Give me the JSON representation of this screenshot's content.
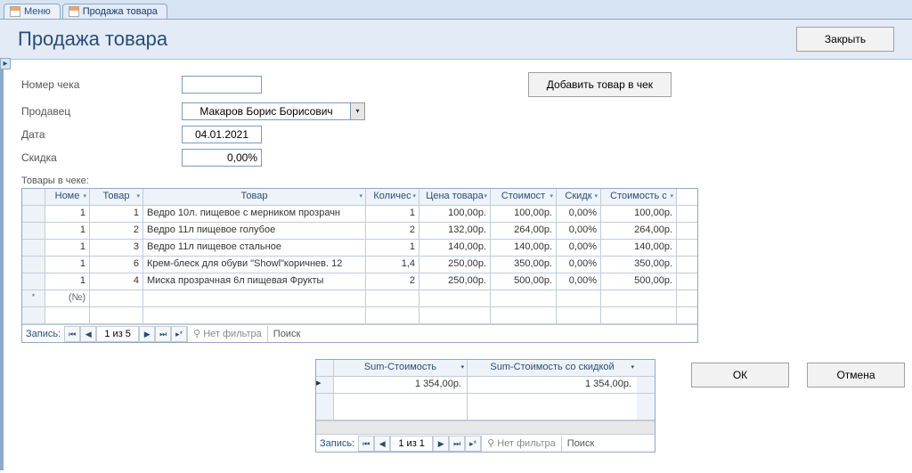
{
  "tabs": [
    {
      "label": "Меню",
      "active": false
    },
    {
      "label": "Продажа товара",
      "active": true
    }
  ],
  "header": {
    "title": "Продажа товара",
    "close_btn": "Закрыть"
  },
  "fields": {
    "check_no_label": "Номер чека",
    "check_no_value": "",
    "seller_label": "Продавец",
    "seller_value": "Макаров Борис Борисович",
    "date_label": "Дата",
    "date_value": "04.01.2021",
    "discount_label": "Скидка",
    "discount_value": "0,00%",
    "add_item_btn": "Добавить товар в чек"
  },
  "items_section_label": "Товары в чеке:",
  "items_columns": {
    "nomer": "Номе",
    "tovar_id": "Товар",
    "tovar": "Товар",
    "kol": "Количес",
    "cena": "Цена товара",
    "stoim": "Стоимост",
    "skidka": "Скидк",
    "stoims": "Стоимость с"
  },
  "items": [
    {
      "nomer": "1",
      "tid": "1",
      "name": "Ведро 10л. пищевое с мерником прозрачн",
      "kol": "1",
      "cena": "100,00р.",
      "stoim": "100,00р.",
      "skid": "0,00%",
      "stoims": "100,00р."
    },
    {
      "nomer": "1",
      "tid": "2",
      "name": "Ведро 11л пищевое голубое",
      "kol": "2",
      "cena": "132,00р.",
      "stoim": "264,00р.",
      "skid": "0,00%",
      "stoims": "264,00р."
    },
    {
      "nomer": "1",
      "tid": "3",
      "name": "Ведро 11л пищевое стальное",
      "kol": "1",
      "cena": "140,00р.",
      "stoim": "140,00р.",
      "skid": "0,00%",
      "stoims": "140,00р."
    },
    {
      "nomer": "1",
      "tid": "6",
      "name": "Крем-блеск для обуви \"Showl\"коричнев. 12",
      "kol": "1,4",
      "cena": "250,00р.",
      "stoim": "350,00р.",
      "skid": "0,00%",
      "stoims": "350,00р."
    },
    {
      "nomer": "1",
      "tid": "4",
      "name": "Миска прозрачная 6л пищевая Фрукты",
      "kol": "2",
      "cena": "250,00р.",
      "stoim": "500,00р.",
      "skid": "0,00%",
      "stoims": "500,00р."
    }
  ],
  "new_row_placeholder": "(№)",
  "nav1": {
    "label": "Запись:",
    "pos": "1 из 5",
    "filter": "Нет фильтра",
    "search": "Поиск"
  },
  "summary_columns": {
    "c1": "Sum-Стоимость",
    "c2": "Sum-Стоимость со скидкой"
  },
  "summary": {
    "c1": "1 354,00р.",
    "c2": "1 354,00р."
  },
  "nav2": {
    "label": "Запись:",
    "pos": "1 из 1",
    "filter": "Нет фильтра",
    "search": "Поиск"
  },
  "action_buttons": {
    "ok": "ОК",
    "cancel": "Отмена"
  }
}
